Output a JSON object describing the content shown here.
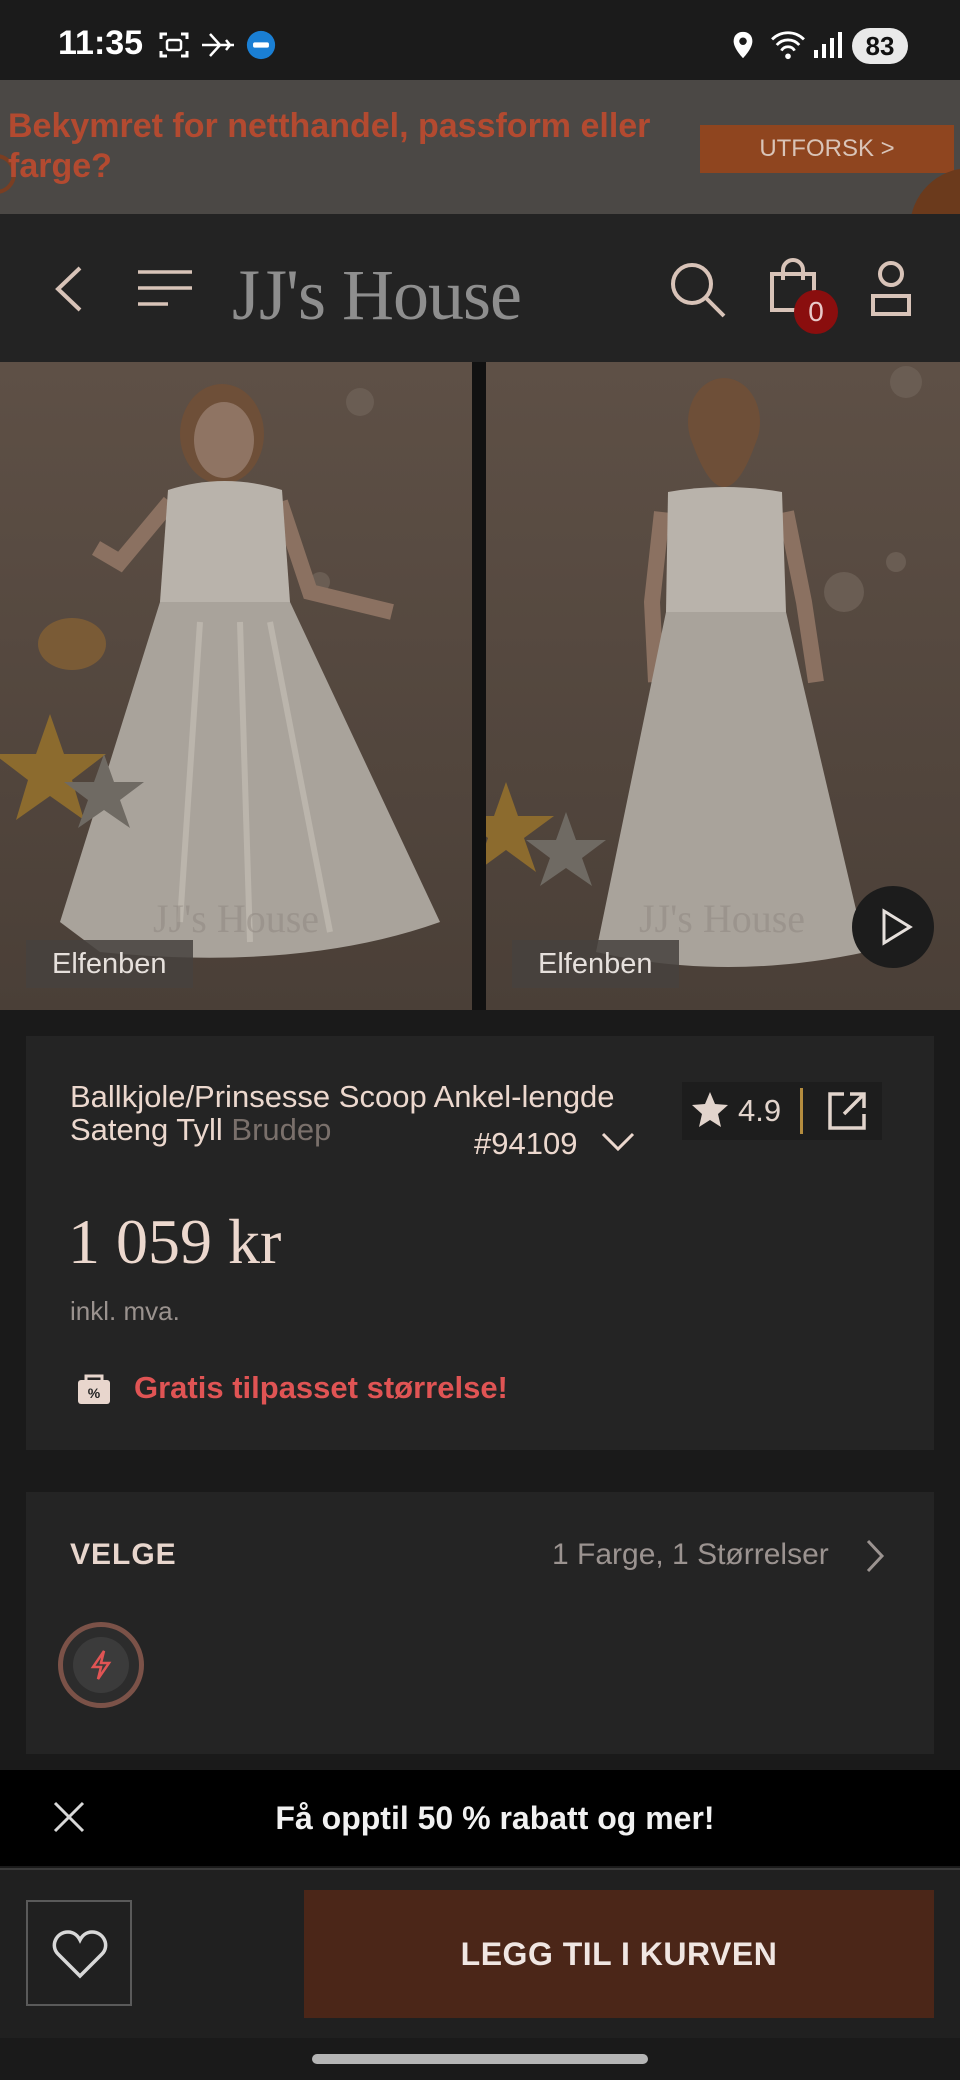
{
  "status_bar": {
    "time": "11:35",
    "battery": "83",
    "icons": [
      "screenshot-icon",
      "airplane-mode-icon",
      "app-notification-icon",
      "location-icon",
      "wifi-icon",
      "signal-icon"
    ]
  },
  "promo": {
    "text": "Bekymret for netthandel, passform eller farge?",
    "button_label": "UTFORSK >"
  },
  "header": {
    "logo": "JJ's House",
    "cart_count": "0"
  },
  "gallery": {
    "images": [
      {
        "color_label": "Elfenben",
        "view": "front"
      },
      {
        "color_label": "Elfenben",
        "view": "back"
      }
    ],
    "watermark": "JJ's House"
  },
  "product": {
    "title_visible": "Ballkjole/Prinsesse Scoop Ankel-lengde Sateng Tyll ",
    "title_faded": "Brudep",
    "sku": "#94109",
    "rating": "4.9",
    "price": "1 059 kr",
    "vat_note": "inkl. mva.",
    "free_size": "Gratis tilpasset størrelse!"
  },
  "select": {
    "label": "VELGE",
    "summary": "1 Farge, 1 Størrelser"
  },
  "discount_bar": {
    "text": "Få opptil 50 % rabatt og mer!"
  },
  "bottom_bar": {
    "add_to_cart": "LEGG TIL I KURVEN"
  },
  "colors": {
    "accent_brown": "#4b2618",
    "badge_red": "#8a0e0e",
    "promo_text": "#b34a30",
    "free_size_red": "#e05454"
  }
}
